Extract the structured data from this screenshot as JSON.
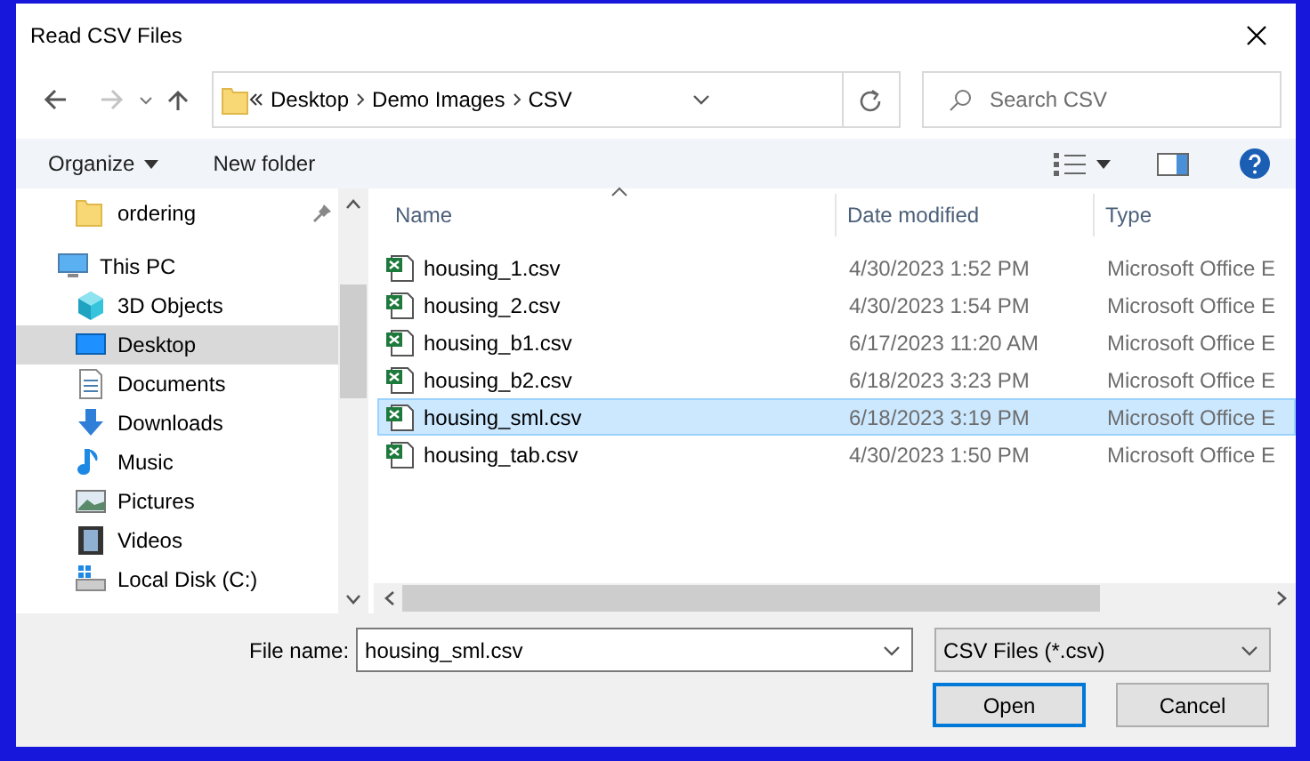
{
  "window": {
    "title": "Read CSV Files"
  },
  "nav": {
    "back": {
      "disabled": false
    },
    "forward": {
      "disabled": true
    }
  },
  "address": {
    "crumbs": [
      "Desktop",
      "Demo Images",
      "CSV"
    ]
  },
  "search": {
    "placeholder": "Search CSV"
  },
  "toolbar": {
    "organize": "Organize",
    "new_folder": "New folder"
  },
  "sidebar": {
    "items": [
      {
        "label": "ordering",
        "kind": "folder",
        "pinned": true,
        "selected": false
      },
      {
        "label": "This PC",
        "kind": "pc",
        "pinned": false,
        "selected": false,
        "children": [
          {
            "label": "3D Objects",
            "kind": "cube",
            "selected": false
          },
          {
            "label": "Desktop",
            "kind": "desktop",
            "selected": true
          },
          {
            "label": "Documents",
            "kind": "documents",
            "selected": false
          },
          {
            "label": "Downloads",
            "kind": "downloads",
            "selected": false
          },
          {
            "label": "Music",
            "kind": "music",
            "selected": false
          },
          {
            "label": "Pictures",
            "kind": "pictures",
            "selected": false
          },
          {
            "label": "Videos",
            "kind": "videos",
            "selected": false
          },
          {
            "label": "Local Disk (C:)",
            "kind": "disk",
            "selected": false
          }
        ]
      }
    ]
  },
  "files": {
    "columns": [
      "Name",
      "Date modified",
      "Type"
    ],
    "rows": [
      {
        "name": "housing_1.csv",
        "date": "4/30/2023 1:52 PM",
        "type": "Microsoft Office E",
        "selected": false
      },
      {
        "name": "housing_2.csv",
        "date": "4/30/2023 1:54 PM",
        "type": "Microsoft Office E",
        "selected": false
      },
      {
        "name": "housing_b1.csv",
        "date": "6/17/2023 11:20 AM",
        "type": "Microsoft Office E",
        "selected": false
      },
      {
        "name": "housing_b2.csv",
        "date": "6/18/2023 3:23 PM",
        "type": "Microsoft Office E",
        "selected": false
      },
      {
        "name": "housing_sml.csv",
        "date": "6/18/2023 3:19 PM",
        "type": "Microsoft Office E",
        "selected": true
      },
      {
        "name": "housing_tab.csv",
        "date": "4/30/2023 1:50 PM",
        "type": "Microsoft Office E",
        "selected": false
      }
    ]
  },
  "footer": {
    "file_name_label": "File name:",
    "file_name": "housing_sml.csv",
    "file_type": "CSV Files (*.csv)",
    "buttons": [
      {
        "label": "Open",
        "default": true
      },
      {
        "label": "Cancel",
        "default": false
      }
    ]
  }
}
